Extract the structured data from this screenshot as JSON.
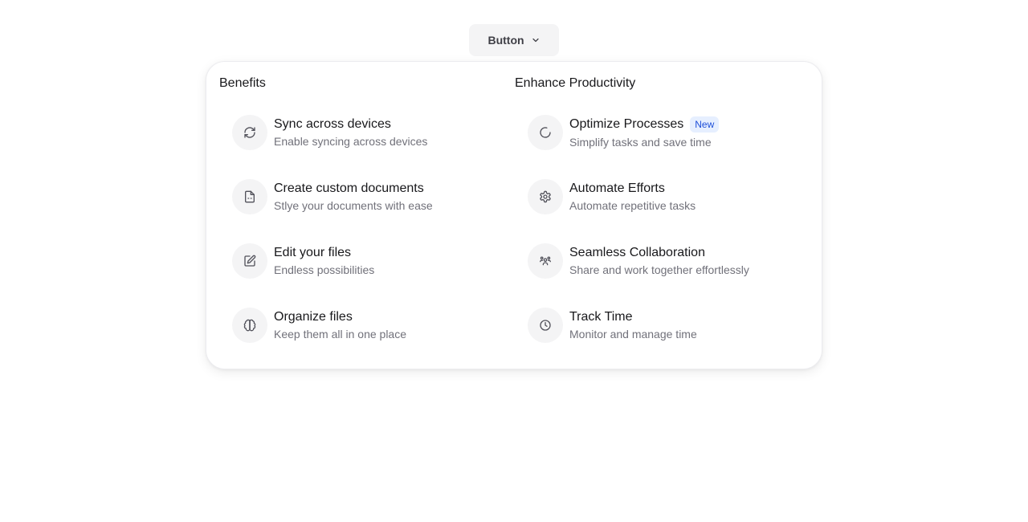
{
  "trigger": {
    "label": "Button",
    "icon": "chevron-down-icon"
  },
  "columns": [
    {
      "heading": "Benefits",
      "items": [
        {
          "title": "Sync across devices",
          "description": "Enable syncing across devices",
          "icon": "refresh-icon"
        },
        {
          "title": "Create custom documents",
          "description": "Stlye your documents with ease",
          "icon": "document-icon"
        },
        {
          "title": "Edit your files",
          "description": "Endless possibilities",
          "icon": "edit-icon"
        },
        {
          "title": "Organize files",
          "description": "Keep them all in one place",
          "icon": "brain-icon"
        }
      ]
    },
    {
      "heading": "Enhance Productivity",
      "items": [
        {
          "title": "Optimize Processes",
          "badge": "New",
          "description": "Simplify tasks and save time",
          "icon": "loader-icon"
        },
        {
          "title": "Automate Efforts",
          "description": "Automate repetitive tasks",
          "icon": "settings-icon"
        },
        {
          "title": "Seamless Collaboration",
          "description": "Share and work together effortlessly",
          "icon": "users-icon"
        },
        {
          "title": "Track Time",
          "description": "Monitor and manage time",
          "icon": "clock-icon"
        }
      ]
    }
  ],
  "colors": {
    "badge_bg": "#e6efff",
    "badge_text": "#1d4ed8",
    "icon_bg": "#f4f4f5"
  }
}
